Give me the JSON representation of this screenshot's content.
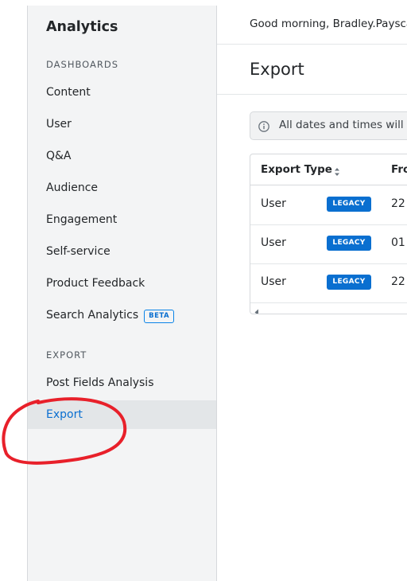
{
  "sidebar": {
    "title": "Analytics",
    "dashboards_label": "DASHBOARDS",
    "dashboards": [
      {
        "label": "Content"
      },
      {
        "label": "User"
      },
      {
        "label": "Q&A"
      },
      {
        "label": "Audience"
      },
      {
        "label": "Engagement"
      },
      {
        "label": "Self-service"
      },
      {
        "label": "Product Feedback"
      },
      {
        "label": "Search Analytics",
        "badge": "BETA"
      }
    ],
    "export_label": "EXPORT",
    "export_items": [
      {
        "label": "Post Fields Analysis"
      },
      {
        "label": "Export",
        "selected": true
      }
    ]
  },
  "header": {
    "greeting": "Good morning, Bradley.Paysca"
  },
  "main": {
    "title": "Export",
    "notice": "All dates and times will b",
    "table": {
      "columns": [
        "Export Type",
        "Fro"
      ],
      "rows": [
        {
          "type": "User",
          "badge": "LEGACY",
          "from": "22"
        },
        {
          "type": "User",
          "badge": "LEGACY",
          "from": "01"
        },
        {
          "type": "User",
          "badge": "LEGACY",
          "from": "22"
        }
      ]
    }
  },
  "colors": {
    "accent": "#0a6fd0",
    "sidebar_bg": "#f3f4f5",
    "selected_bg": "#e3e6e8",
    "annotation": "#e8202a"
  },
  "icons": {
    "info": "info-icon",
    "sort": "sort-icon",
    "scroll_left": "scroll-left-icon"
  }
}
